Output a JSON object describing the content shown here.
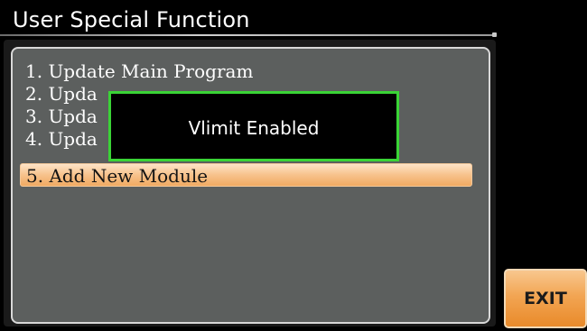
{
  "screen": {
    "title": "User Special Function"
  },
  "menu": {
    "items": [
      {
        "label": "1. Update Main Program",
        "selected": false
      },
      {
        "label": "2. Upda",
        "selected": false
      },
      {
        "label": "3. Upda",
        "selected": false
      },
      {
        "label": "4. Upda",
        "selected": false
      },
      {
        "label": "5. Add New Module",
        "selected": true
      }
    ]
  },
  "popup": {
    "message": "Vlimit Enabled"
  },
  "softkeys": {
    "exit_label": "EXIT"
  },
  "colors": {
    "background": "#000000",
    "panel": "#5c5f5e",
    "highlight": "#f2a553",
    "popup_border": "#3ad436"
  }
}
